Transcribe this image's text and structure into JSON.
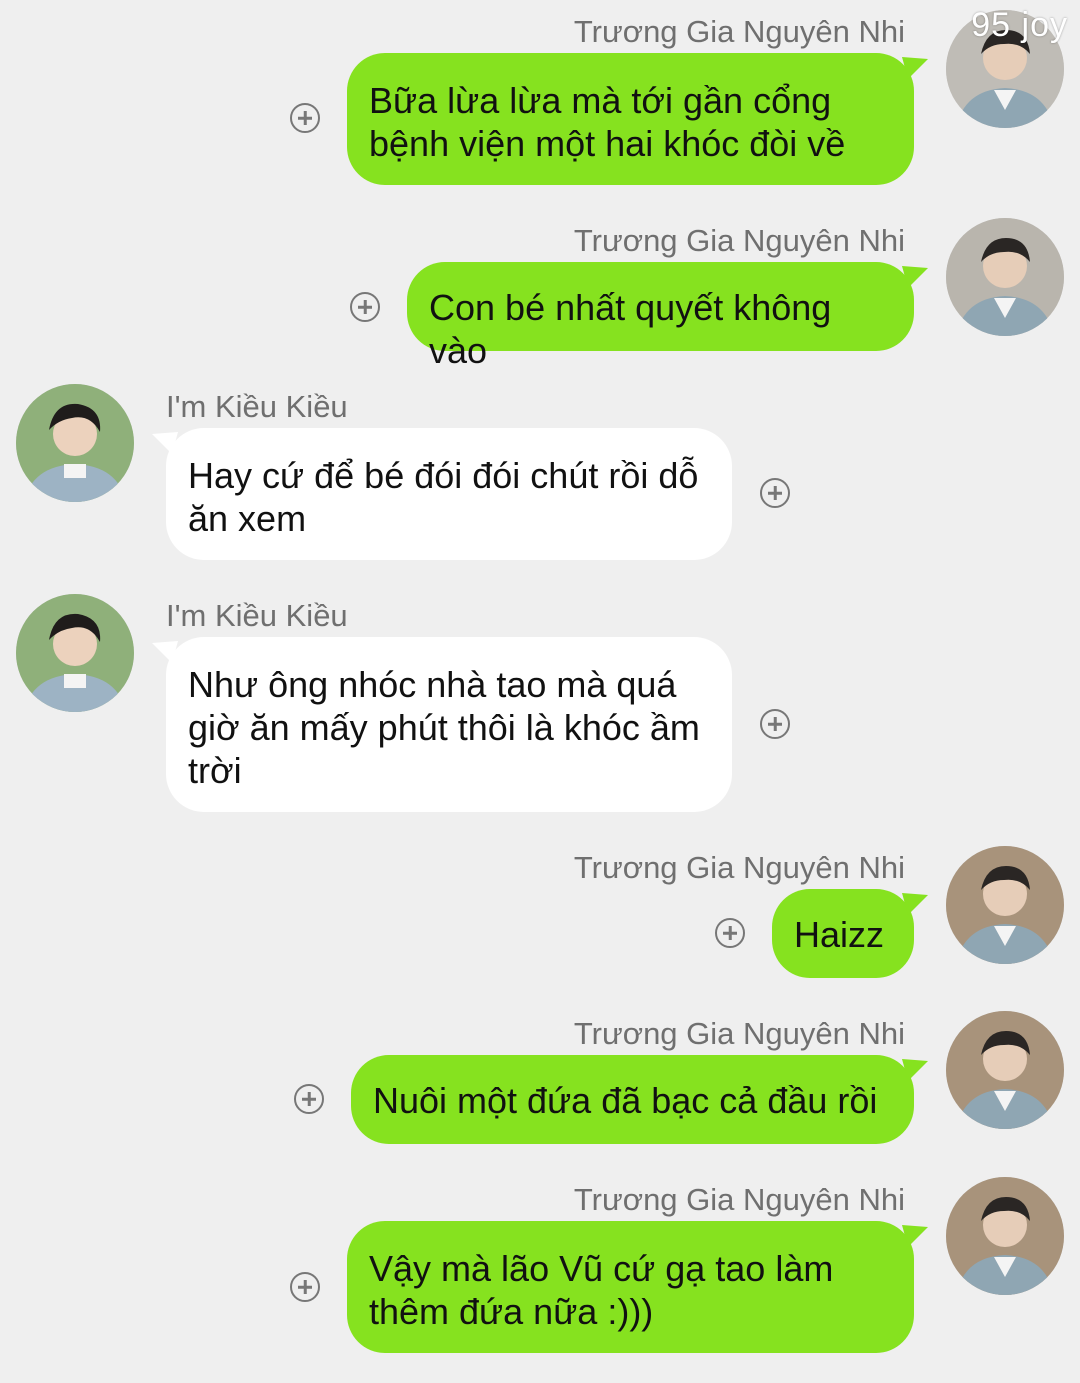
{
  "watermark": "95 joy",
  "colors": {
    "background": "#efefef",
    "outgoing_bubble": "#86e21f",
    "incoming_bubble": "#ffffff",
    "name_text": "#6f6f6f"
  },
  "messages": [
    {
      "sender": "Trương Gia Nguyên Nhi",
      "side": "right",
      "text": "Bữa lừa lừa mà tới gần cổng\nbệnh viện một hai khóc đòi về",
      "action_icon": "add-circle-icon"
    },
    {
      "sender": "Trương Gia Nguyên Nhi",
      "side": "right",
      "text": "Con bé nhất quyết không vào",
      "action_icon": "add-circle-icon"
    },
    {
      "sender": "I'm Kiều Kiều",
      "side": "left",
      "text": "Hay cứ để bé đói đói chút rồi dỗ\năn xem",
      "action_icon": "add-circle-icon"
    },
    {
      "sender": "I'm Kiều Kiều",
      "side": "left",
      "text": "Như ông nhóc nhà tao mà quá\ngiờ ăn mấy phút thôi là khóc ầm\ntrời",
      "action_icon": "add-circle-icon"
    },
    {
      "sender": "Trương Gia Nguyên Nhi",
      "side": "right",
      "text": "Haizz",
      "action_icon": "add-circle-icon"
    },
    {
      "sender": "Trương Gia Nguyên Nhi",
      "side": "right",
      "text": "Nuôi một đứa đã bạc cả đầu rồi",
      "action_icon": "add-circle-icon"
    },
    {
      "sender": "Trương Gia Nguyên Nhi",
      "side": "right",
      "text": "Vậy mà lão Vũ cứ gạ tao làm\nthêm đứa nữa :)))",
      "action_icon": "add-circle-icon"
    }
  ]
}
